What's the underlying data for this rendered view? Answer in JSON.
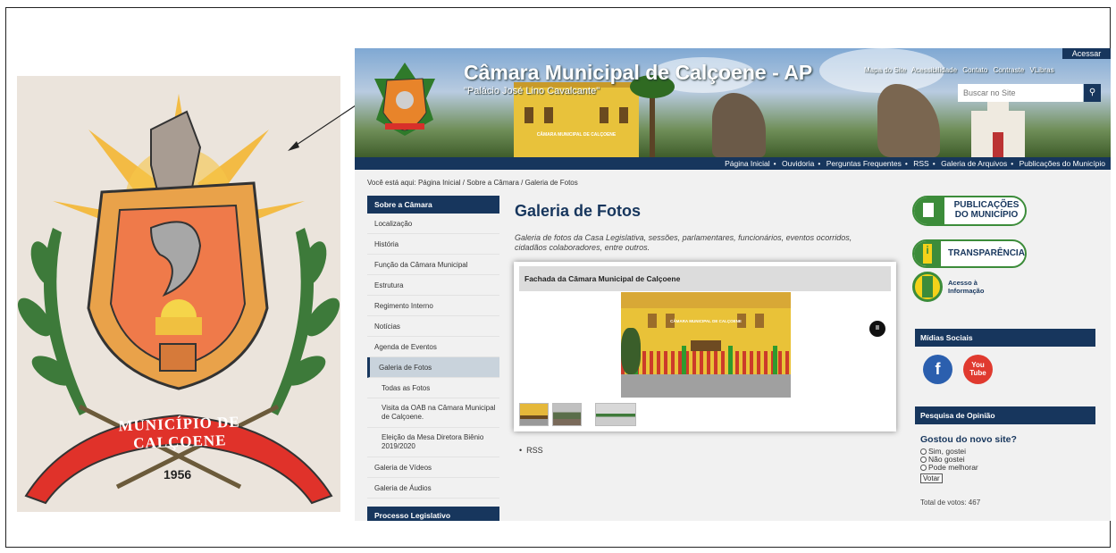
{
  "coat_of_arms": {
    "ribbon_text": "MUNICÍPIO DE CALÇOENE",
    "year": "1956"
  },
  "header": {
    "title": "Câmara Municipal de Calçoene - AP",
    "subtitle": "\"Palácio José Lino Cavalcante\"",
    "banner_building_label": "CÂMARA MUNICIPAL DE CALÇOENE",
    "login_label": "Acessar",
    "top_links": [
      "Mapa do Site",
      "Acessibilidade",
      "Contato",
      "Contraste",
      "VLibras"
    ],
    "search_placeholder": "Buscar no Site"
  },
  "nav": {
    "items": [
      "Página Inicial",
      "Ouvidoria",
      "Perguntas Frequentes",
      "RSS",
      "Galeria de Arquivos",
      "Publicações do Município"
    ]
  },
  "breadcrumb": {
    "prefix": "Você está aqui:",
    "items": [
      "Página Inicial",
      "Sobre a Câmara",
      "Galeria de Fotos"
    ]
  },
  "sidebar": {
    "heading": "Sobre a Câmara",
    "items": [
      "Localização",
      "História",
      "Função da Câmara Municipal",
      "Estrutura",
      "Regimento Interno",
      "Notícias",
      "Agenda de Eventos",
      "Galeria de Fotos"
    ],
    "subitems": [
      "Todas as Fotos",
      "Visita da OAB na Câmara Municipal de Calçoene.",
      "Eleição da Mesa Diretora Biênio 2019/2020"
    ],
    "after_items": [
      "Galeria de Vídeos",
      "Galeria de Áudios"
    ],
    "heading2": "Processo Legislativo"
  },
  "main": {
    "title": "Galeria de Fotos",
    "description": "Galeria de fotos da Casa Legislativa, sessões, parlamentares, funcionários, eventos ocorridos, cidadãos colaboradores, entre outros.",
    "gallery_title": "Fachada da Câmara Municipal de Calçoene",
    "photo_label": "CÂMARA MUNICIPAL DE CALÇOENE",
    "rss_label": "RSS"
  },
  "right": {
    "publicacoes": "PUBLICAÇÕES DO MUNICÍPIO",
    "transparencia": "TRANSPARÊNCIA",
    "acesso": "Acesso à Informação",
    "midias_heading": "Mídias Sociais",
    "youtube_label": "You Tube",
    "poll_heading": "Pesquisa de Opinião",
    "poll_question": "Gostou do novo site?",
    "poll_options": [
      "Sim, gostei",
      "Não gostei",
      "Pode melhorar"
    ],
    "vote_label": "Votar",
    "total_votes": "Total de votos: 467"
  },
  "colors": {
    "navy": "#17365d",
    "green": "#3c8c3a"
  }
}
